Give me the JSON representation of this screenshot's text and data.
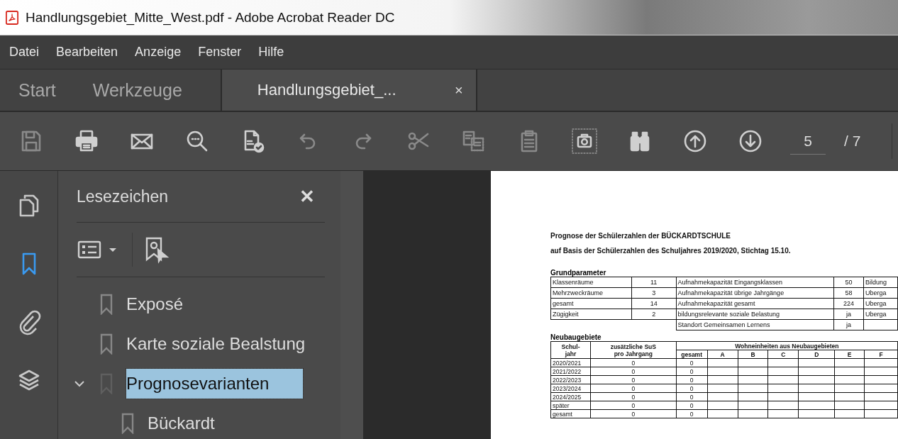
{
  "window": {
    "title": "Handlungsgebiet_Mitte_West.pdf - Adobe Acrobat Reader DC"
  },
  "menu": [
    "Datei",
    "Bearbeiten",
    "Anzeige",
    "Fenster",
    "Hilfe"
  ],
  "tabs": [
    {
      "label": "Start",
      "selected": false
    },
    {
      "label": "Werkzeuge",
      "selected": false
    },
    {
      "label": "Handlungsgebiet_...",
      "selected": true,
      "close": "×"
    }
  ],
  "toolbar": {
    "tools": [
      {
        "kind": "save",
        "disabled": true,
        "active": false
      },
      {
        "kind": "print",
        "disabled": false,
        "active": false
      },
      {
        "kind": "email",
        "disabled": false,
        "active": false
      },
      {
        "kind": "zoom",
        "disabled": false,
        "active": false
      },
      {
        "kind": "spellcheck",
        "disabled": false,
        "active": false
      },
      {
        "kind": "undo",
        "disabled": true,
        "active": false
      },
      {
        "kind": "redo",
        "disabled": true,
        "active": false
      },
      {
        "kind": "cut",
        "disabled": true,
        "active": false
      },
      {
        "kind": "copy",
        "disabled": true,
        "active": false
      },
      {
        "kind": "paste",
        "disabled": true,
        "active": false
      },
      {
        "kind": "snapshot",
        "disabled": false,
        "active": true
      },
      {
        "kind": "find",
        "disabled": false,
        "active": false
      },
      {
        "kind": "page-up",
        "disabled": false,
        "active": false
      },
      {
        "kind": "page-down",
        "disabled": false,
        "active": false
      }
    ],
    "page": {
      "current": "5",
      "total": "/ 7"
    }
  },
  "rail": [
    {
      "kind": "pages",
      "selected": false
    },
    {
      "kind": "bookmarks",
      "selected": true
    },
    {
      "kind": "attachments",
      "selected": false
    },
    {
      "kind": "layers",
      "selected": false
    }
  ],
  "bookmarks": {
    "title": "Lesezeichen",
    "close": "✕",
    "items": [
      {
        "label": "Exposé",
        "selected": false
      },
      {
        "label": "Karte soziale Bealstung",
        "selected": false
      },
      {
        "label": "Prognosevarianten",
        "selected": true,
        "expanded": true,
        "children": [
          {
            "label": "Bückardt",
            "selected": false
          }
        ]
      }
    ]
  },
  "document": {
    "headings": [
      "Prognose der Schülerzahlen der BÜCKARDTSCHULE",
      "auf Basis der Schülerzahlen des Schuljahres 2019/2020, Stichtag 15.10."
    ],
    "params_title": "Grundparameter",
    "params": [
      {
        "label": "Klassenräume",
        "value": "11",
        "param": "Aufnahmekapazität Eingangsklassen",
        "param_value": "50",
        "note": "Bildung"
      },
      {
        "label": "Mehrzweckräume",
        "value": "3",
        "param": "Aufnahmekapazität übrige Jahrgänge",
        "param_value": "58",
        "note": "Uberga"
      },
      {
        "label": "gesamt",
        "value": "14",
        "param": "Aufnahmekapazität gesamt",
        "param_value": "224",
        "note": "Uberga"
      },
      {
        "label": "Zügigkeit",
        "value": "2",
        "param": "bildungsrelevante soziale Belastung",
        "param_value": "ja",
        "note": "Uberga"
      },
      {
        "param": "Standort Gemeinsamen Lernens",
        "param_value": "ja"
      }
    ],
    "new_title": "Neubaugebiete",
    "new_table": {
      "year_header": "Schul-\njahr",
      "extra_header": "zusätzliche SuS\npro Jahrgang",
      "group_header": "Wohneinheiten aus Neubaugebieten",
      "total_header": "gesamt",
      "unit_columns": [
        "A",
        "B",
        "C",
        "D",
        "E",
        "F"
      ],
      "rows": [
        {
          "year": "2020/2021",
          "extra": "0",
          "total": "0"
        },
        {
          "year": "2021/2022",
          "extra": "0",
          "total": "0"
        },
        {
          "year": "2022/2023",
          "extra": "0",
          "total": "0"
        },
        {
          "year": "2023/2024",
          "extra": "0",
          "total": "0"
        },
        {
          "year": "2024/2025",
          "extra": "0",
          "total": "0"
        },
        {
          "year": "später",
          "extra": "0",
          "total": "0"
        },
        {
          "year": "gesamt",
          "extra": "0",
          "total": "0"
        }
      ]
    }
  }
}
